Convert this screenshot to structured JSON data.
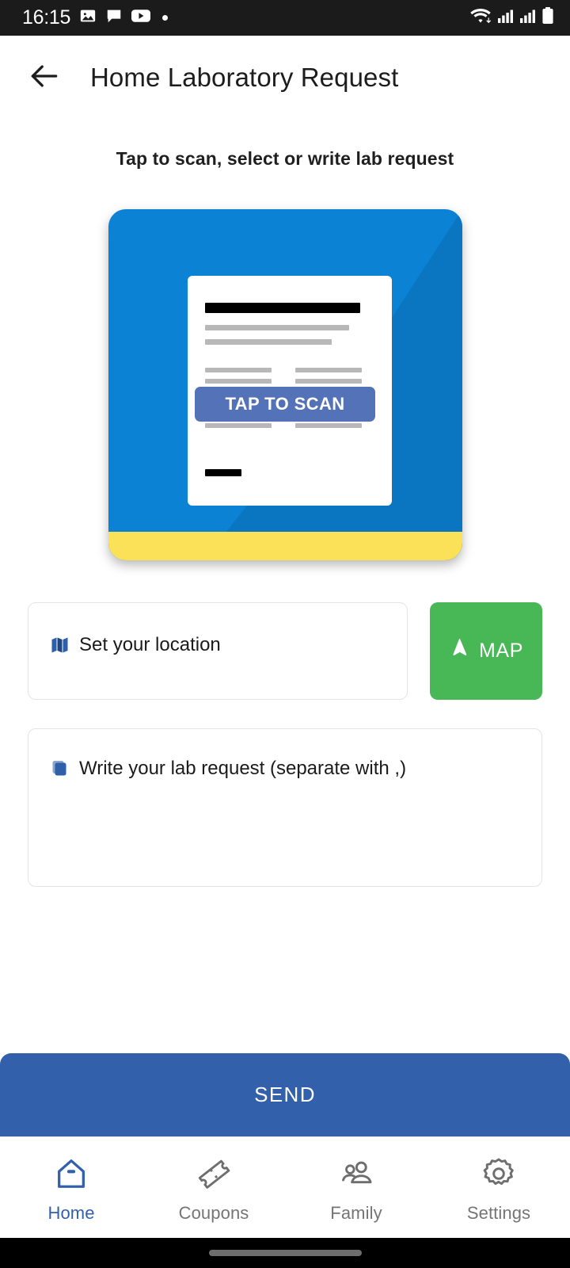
{
  "status_bar": {
    "time": "16:15",
    "left_icons": [
      "image-icon",
      "chat-icon",
      "youtube-icon",
      "dot-icon"
    ],
    "right_icons": [
      "wifi-icon",
      "signal-icon-1",
      "signal-icon-2",
      "battery-icon"
    ],
    "background": "#1b1b1b"
  },
  "app_bar": {
    "back_icon": "arrow-left-icon",
    "title": "Home Laboratory Request"
  },
  "main": {
    "subtitle": "Tap to scan, select or write lab request",
    "scan_card": {
      "banner_label": "TAP TO SCAN",
      "card_color": "#0b82d4",
      "accent_color": "#fbe158",
      "banner_color": "#5472b8",
      "paper_color": "#ffffff"
    },
    "location": {
      "icon": "map-folded-icon",
      "placeholder": "Set your location",
      "value": "",
      "map_button": {
        "label": "MAP",
        "icon": "navigation-arrow-icon",
        "color": "#48b755"
      }
    },
    "lab_request": {
      "icon": "copy-stack-icon",
      "placeholder": "Write your lab request (separate with ,)",
      "value": ""
    },
    "send_button": {
      "label": "SEND",
      "color": "#3360ab"
    }
  },
  "bottom_nav": {
    "active_color": "#3360ab",
    "inactive_color": "#757575",
    "items": [
      {
        "label": "Home",
        "icon": "home-icon",
        "active": true
      },
      {
        "label": "Coupons",
        "icon": "ticket-icon",
        "active": false
      },
      {
        "label": "Family",
        "icon": "people-icon",
        "active": false
      },
      {
        "label": "Settings",
        "icon": "gear-icon",
        "active": false
      }
    ]
  }
}
